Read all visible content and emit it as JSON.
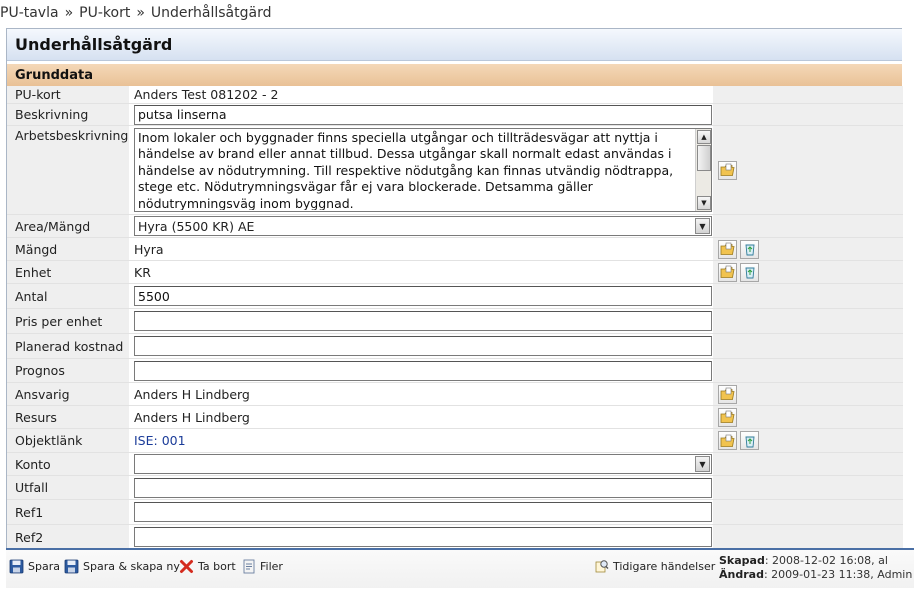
{
  "breadcrumb": [
    "PU-tavla",
    "PU-kort",
    "Underhållsåtgärd"
  ],
  "breadcrumb_sep": "»",
  "panel": {
    "title": "Underhållsåtgärd",
    "section": "Grunddata"
  },
  "fields": {
    "pukort": {
      "label": "PU-kort",
      "value": "Anders Test 081202 - 2"
    },
    "beskrivning": {
      "label": "Beskrivning",
      "value": "putsa linserna"
    },
    "arbetsbeskrivning": {
      "label": "Arbetsbeskrivning",
      "value": "Inom lokaler och byggnader finns speciella utgångar och tillträdesvägar att nyttja i händelse av brand eller annat tillbud. Dessa utgångar skall normalt edast användas i händelse av nödutrymning. Till respektive nödutgång kan finnas utvändig nödtrappa, stege etc. Nödutrymningsvägar får ej vara blockerade. Detsamma gäller nödutrymningsväg inom byggnad."
    },
    "area": {
      "label": "Area/Mängd",
      "value": "Hyra (5500 KR) AE"
    },
    "mangd": {
      "label": "Mängd",
      "value": "Hyra"
    },
    "enhet": {
      "label": "Enhet",
      "value": "KR"
    },
    "antal": {
      "label": "Antal",
      "value": "5500"
    },
    "pris": {
      "label": "Pris per enhet",
      "value": ""
    },
    "planerad": {
      "label": "Planerad kostnad",
      "value": ""
    },
    "prognos": {
      "label": "Prognos",
      "value": ""
    },
    "ansvarig": {
      "label": "Ansvarig",
      "value": "Anders H Lindberg"
    },
    "resurs": {
      "label": "Resurs",
      "value": "Anders H Lindberg"
    },
    "objektlank": {
      "label": "Objektlänk",
      "value": "ISE: 001"
    },
    "konto": {
      "label": "Konto",
      "value": ""
    },
    "utfall": {
      "label": "Utfall",
      "value": ""
    },
    "ref1": {
      "label": "Ref1",
      "value": ""
    },
    "ref2": {
      "label": "Ref2",
      "value": ""
    }
  },
  "toolbar": {
    "save": "Spara",
    "save_new": "Spara & skapa ny",
    "delete": "Ta bort",
    "files": "Filer",
    "history": "Tidigare händelser"
  },
  "meta": {
    "created_label": "Skapad",
    "created_value": ": 2008-12-02 16:08, al",
    "changed_label": "Ändrad",
    "changed_value": ": 2009-01-23 11:38, Admin"
  },
  "icons": {
    "pick": "folder-pick-icon",
    "clear": "recycle-clear-icon",
    "save": "floppy-disk-icon",
    "delete": "red-x-icon",
    "files": "document-icon",
    "history": "magnifier-history-icon"
  },
  "colors": {
    "title_bar": "#d6e1f1",
    "section_bar": "#e9c196",
    "label_bg": "#efefef",
    "footer_border": "#4a6fa5",
    "link": "#1b3c99"
  }
}
